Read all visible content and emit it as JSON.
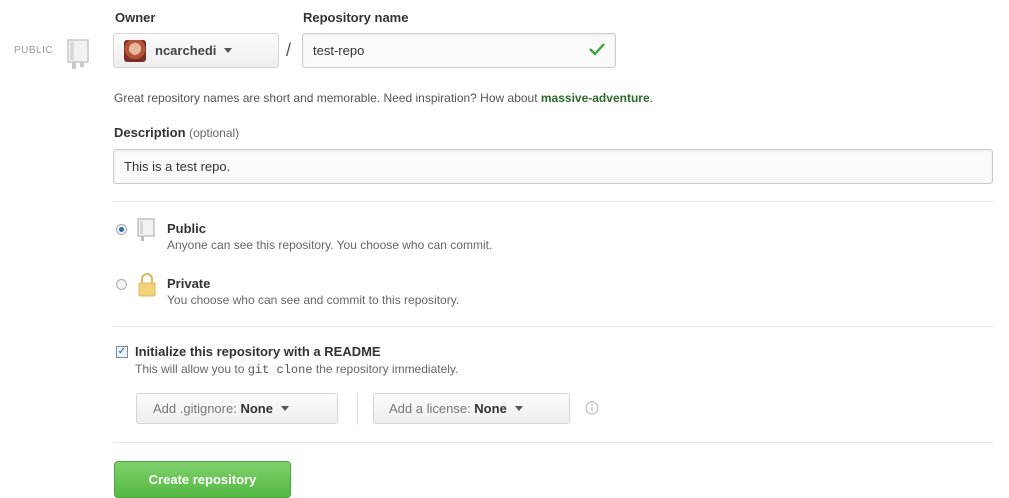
{
  "side": {
    "visibility_tag": "PUBLIC"
  },
  "owner": {
    "label": "Owner",
    "username": "ncarchedi"
  },
  "repo_name": {
    "label": "Repository name",
    "separator": "/",
    "value": "test-repo"
  },
  "hint": {
    "prefix": "Great repository names are short and memorable. Need inspiration? How about ",
    "suggestion": "massive-adventure",
    "suffix": "."
  },
  "description": {
    "label": "Description",
    "optional": "(optional)",
    "value": "This is a test repo."
  },
  "visibility": {
    "public": {
      "title": "Public",
      "desc": "Anyone can see this repository. You choose who can commit.",
      "selected": true
    },
    "private": {
      "title": "Private",
      "desc": "You choose who can see and commit to this repository.",
      "selected": false
    }
  },
  "readme": {
    "checked": true,
    "title": "Initialize this repository with a README",
    "desc_prefix": "This will allow you to ",
    "desc_code": "git clone",
    "desc_suffix": " the repository immediately."
  },
  "gitignore": {
    "label": "Add .gitignore:",
    "value": "None"
  },
  "license": {
    "label": "Add a license:",
    "value": "None"
  },
  "info_icon": "info-icon",
  "create_button": {
    "label": "Create repository"
  },
  "colors": {
    "accent_green": "#55b944",
    "link_green": "#2a6b2a",
    "check_green": "#3aa53a"
  }
}
